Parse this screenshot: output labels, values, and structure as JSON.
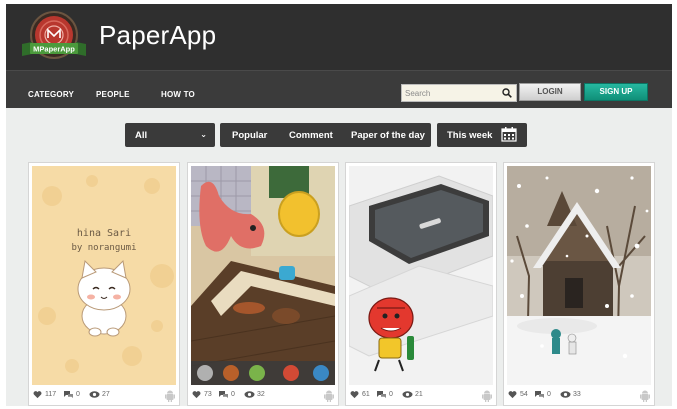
{
  "header": {
    "logo_text": "MPaperApp",
    "app_title": "PaperApp"
  },
  "nav": {
    "items": [
      {
        "label": "CATEGORY"
      },
      {
        "label": "PEOPLE"
      },
      {
        "label": "HOW TO"
      }
    ],
    "search_placeholder": "Search",
    "login_label": "LOGIN",
    "signup_label": "SIGN UP"
  },
  "filters": {
    "all_label": "All",
    "popular_label": "Popular",
    "comment_label": "Comment",
    "paper_of_day_label": "Paper of the day",
    "this_week_label": "This week"
  },
  "cards": [
    {
      "likes": "117",
      "comments": "0",
      "views": "27",
      "art_text_1": "hina Sari",
      "art_text_2": "by norangumi"
    },
    {
      "likes": "73",
      "comments": "0",
      "views": "32"
    },
    {
      "likes": "61",
      "comments": "0",
      "views": "21"
    },
    {
      "likes": "54",
      "comments": "0",
      "views": "33"
    }
  ],
  "colors": {
    "header_bg": "#2f2f2f",
    "nav_bg": "#3b3b3b",
    "signup_accent": "#129a82",
    "page_bg": "#eceeed"
  }
}
